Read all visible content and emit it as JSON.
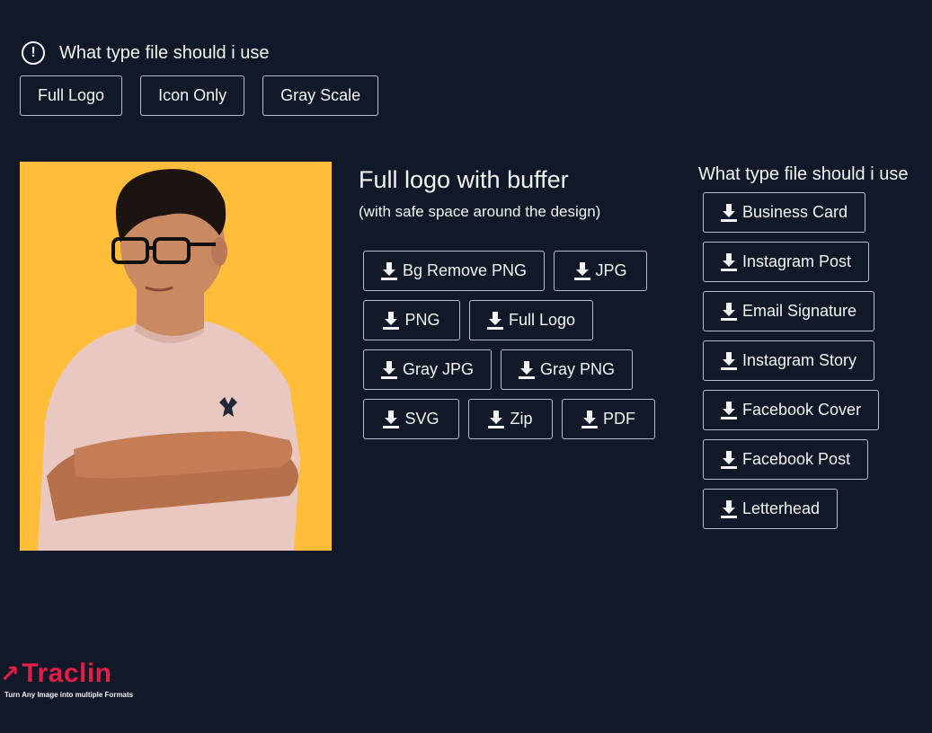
{
  "header": {
    "title": "What type file should i use",
    "icon": "exclamation-circle-icon"
  },
  "tabs": [
    {
      "label": "Full Logo"
    },
    {
      "label": "Icon Only"
    },
    {
      "label": "Gray Scale"
    }
  ],
  "preview": {
    "background_color": "#ffbd3a"
  },
  "middle": {
    "title": "Full logo with buffer",
    "subtitle": "(with safe space around the design)",
    "downloads": [
      {
        "label": "Bg Remove PNG"
      },
      {
        "label": "JPG"
      },
      {
        "label": "PNG"
      },
      {
        "label": "Full Logo"
      },
      {
        "label": "Gray JPG"
      },
      {
        "label": "Gray PNG"
      },
      {
        "label": "SVG"
      },
      {
        "label": "Zip"
      },
      {
        "label": "PDF"
      }
    ]
  },
  "right": {
    "title": "What type file should i use",
    "downloads": [
      {
        "label": "Business Card"
      },
      {
        "label": "Instagram Post"
      },
      {
        "label": "Email Signature"
      },
      {
        "label": "Instagram Story"
      },
      {
        "label": "Facebook Cover"
      },
      {
        "label": "Facebook Post"
      },
      {
        "label": "Letterhead"
      }
    ]
  },
  "brand": {
    "name": "Traclin",
    "tagline": "Turn Any Image into multiple Formats",
    "color": "#e11d48"
  },
  "colors": {
    "background": "#111827",
    "text": "#f3f4f6",
    "border": "#b8bcc6"
  }
}
